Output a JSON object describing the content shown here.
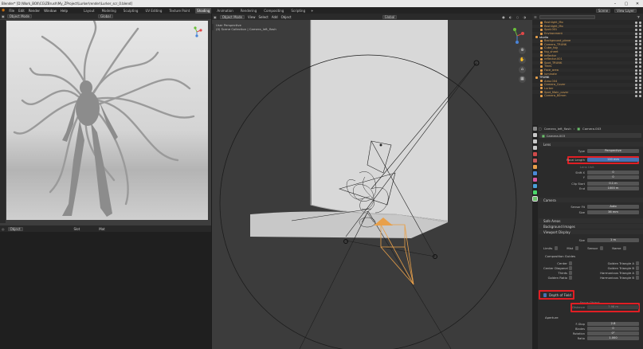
{
  "window": {
    "title": "Blender* [D:\\Work_BOX\\CG\\ZBrush\\My_ZProject\\Lurker\\render\\Lurker_scr_0.blend]",
    "controls": [
      "–",
      "▢",
      "✕"
    ]
  },
  "menubar": {
    "menus": [
      "File",
      "Edit",
      "Render",
      "Window",
      "Help"
    ],
    "workspaces": [
      "Layout",
      "Modeling",
      "Sculpting",
      "UV Editing",
      "Texture Paint",
      "Shading",
      "Animation",
      "Rendering",
      "Compositing",
      "Scripting"
    ],
    "active_workspace": "Shading",
    "scene_label": "Scene",
    "view_layer_label": "View Layer"
  },
  "left_view": {
    "mode": "Object Mode",
    "transform": "Global"
  },
  "bottom_left": {
    "items": [
      "Object",
      "Slot",
      "Mat"
    ]
  },
  "main_view": {
    "mode": "Object Mode",
    "menus": [
      "View",
      "Select",
      "Add",
      "Object"
    ],
    "transform": "Global",
    "overlay_line1": "User Perspective",
    "overlay_line2": "(0) Scene Collection | Camera_left_flash"
  },
  "outliner": {
    "search_placeholder": "",
    "rows": [
      {
        "name": "flashlight_Mo",
        "color": "#d8a35a"
      },
      {
        "name": "flashlight_Mo",
        "color": "#d8a35a"
      },
      {
        "name": "Spot.001",
        "color": "#d8a35a"
      },
      {
        "name": "Environment",
        "color": "#d8a35a"
      },
      {
        "name": "studio",
        "color": "#ffffff"
      },
      {
        "name": "Background_plane",
        "color": "#d8a35a"
      },
      {
        "name": "Camera_TRUNK",
        "color": "#d8a35a"
      },
      {
        "name": "Cube_fog",
        "color": "#d8a35a"
      },
      {
        "name": "fog_sheet",
        "color": "#d8a35a"
      },
      {
        "name": "reflector",
        "color": "#d8a35a"
      },
      {
        "name": "reflector.001",
        "color": "#d8a35a"
      },
      {
        "name": "Spot_TRUNK",
        "color": "#d8a35a"
      },
      {
        "name": "Trees",
        "color": "#d8a35a"
      },
      {
        "name": "Face_area",
        "color": "#d8a35a"
      },
      {
        "name": "luminate",
        "color": "#d8a35a"
      },
      {
        "name": "TRUNK",
        "color": "#ffffff"
      },
      {
        "name": "Area.004",
        "color": "#d8a35a"
      },
      {
        "name": "Camera_Cover",
        "color": "#d8a35a"
      },
      {
        "name": "Lurker",
        "color": "#d8a35a"
      },
      {
        "name": "Spot_Main_cover",
        "color": "#d8a35a"
      },
      {
        "name": "Camera_80mm",
        "color": "#d8a35a"
      }
    ]
  },
  "properties": {
    "breadcrumb_object": "Camera_left_flash",
    "breadcrumb_data": "Camera.003",
    "data_name": "Camera.003",
    "lens_header": "Lens",
    "type_label": "Type",
    "type_value": "Perspective",
    "focal_label": "Focal Length",
    "focal_value": "120 mm",
    "lens_unit": "Lens Unit",
    "shift_x_label": "Shift X",
    "shift_x_value": "0",
    "shift_y_label": "Y",
    "shift_y_value": "0",
    "clip_start_label": "Clip Start",
    "clip_start_value": "0.1 m",
    "clip_end_label": "End",
    "clip_end_value": "1000 m",
    "camera_header": "Camera",
    "sensor_fit_label": "Sensor Fit",
    "sensor_fit_value": "Auto",
    "size_label": "Size",
    "size_value": "36 mm",
    "safe_areas": "Safe Areas",
    "background_images": "Background Images",
    "viewport_display": "Viewport Display",
    "vd_size_label": "Size",
    "vd_size_value": "1 m",
    "limits": "Limits",
    "mist": "Mist",
    "sensor": "Sensor",
    "name": "Name",
    "composition_guides": "Composition Guides",
    "center": "Center",
    "center_diagonal": "Center Diagonal",
    "thirds": "Thirds",
    "golden_ratio": "Golden Ratio",
    "golden_tri_a": "Golden Triangle A",
    "golden_tri_b": "Golden Triangle B",
    "harm_tri_a": "Harmonious Triangle A",
    "harm_tri_b": "Harmonious Triangle B",
    "dof_header": "Depth of Field",
    "focus_object": "Focus Object",
    "distance_label": "Distance",
    "distance_value": "7.98 m",
    "aperture": "Aperture",
    "fstop_label": "F-Stop",
    "fstop_value": "2.8",
    "blades_label": "Blades",
    "blades_value": "0",
    "rotation_label": "Rotation",
    "rotation_value": "0°",
    "ratio_label": "Ratio",
    "ratio_value": "1.000"
  },
  "colors": {
    "highlight": "#e01e24",
    "camera_orange": "#e8a04a",
    "accent_blue": "#4772b3"
  }
}
